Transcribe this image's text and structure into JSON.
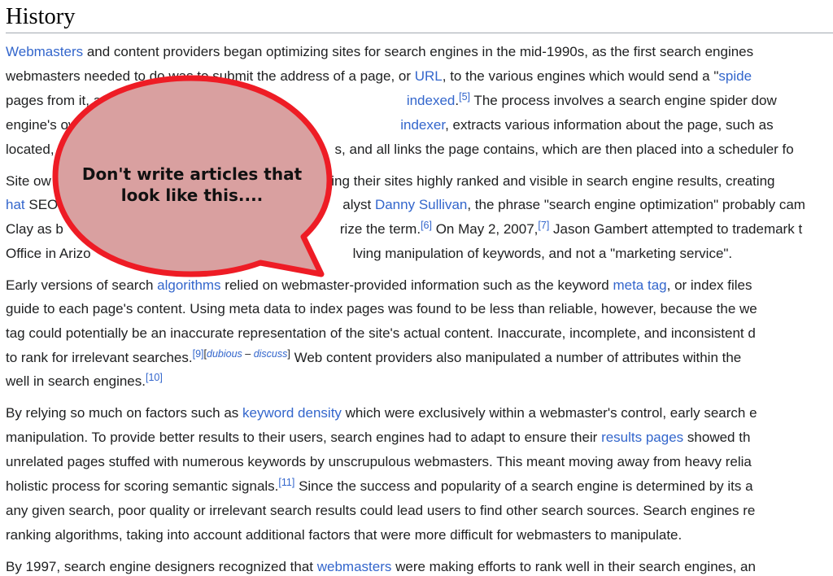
{
  "heading": "History",
  "callout": {
    "line1": "Don't write articles that",
    "line2": "look like this....",
    "fill": "#d9a0a0",
    "stroke": "#ee1c25"
  },
  "colors": {
    "link": "#3366cc",
    "text": "#202122"
  },
  "p1": {
    "l1": {
      "a": "Webmasters",
      "b": " and content providers began optimizing sites for search engines in the mid-1990s, as the first search engines"
    },
    "l2": {
      "a": "webmasters needed to do was to submit the address of a page, or ",
      "b": "URL",
      "c": ", to the various engines which would send a \"",
      "d": "spide"
    },
    "l3": {
      "a": "pages from it, and ",
      "b": "indexed",
      "c": "[5]",
      "d": " The process involves a search engine spider dow"
    },
    "l4": {
      "a": "engine's ow",
      "b": "indexer",
      "c": ", extracts various information about the page, such as"
    },
    "l5": {
      "a": "located,",
      "b": "s, and all links the page contains, which are then placed into a scheduler fo"
    }
  },
  "p2": {
    "l1": {
      "a": "Site ow",
      "b": "ying their sites highly ranked and visible in search engine results, creating"
    },
    "l2": {
      "a": "hat",
      "b": " SEO",
      "c": "alyst ",
      "d": "Danny Sullivan",
      "e": ", the phrase \"search engine optimization\" probably cam"
    },
    "l3": {
      "a": "Clay as b",
      "b": "rize the term.",
      "c": "[6]",
      "d": " On May 2, 2007,",
      "e": "[7]",
      "f": " Jason Gambert attempted to trademark t"
    },
    "l4": {
      "a": "Office in Arizo",
      "b": "lving manipulation of keywords, and not a \"marketing service\"."
    }
  },
  "p3": {
    "l1": {
      "a": "Early versions of search ",
      "b": "algorithms",
      "c": " relied on webmaster-provided information such as the keyword ",
      "d": "meta tag",
      "e": ", or index files"
    },
    "l2": {
      "a": "guide to each page's content. Using meta data to index pages was found to be less than reliable, however, because the we"
    },
    "l3": {
      "a": "tag could potentially be an inaccurate representation of the site's actual content. Inaccurate, incomplete, and inconsistent d"
    },
    "l4": {
      "a": "to rank for irrelevant searches.",
      "b": "[9]",
      "c": "[",
      "d": "dubious",
      "e": " – ",
      "f": "discuss",
      "g": "]",
      "h": " Web content providers also manipulated a number of attributes within the"
    },
    "l5": {
      "a": "well in search engines.",
      "b": "[10]"
    }
  },
  "p4": {
    "l1": {
      "a": "By relying so much on factors such as ",
      "b": "keyword density",
      "c": " which were exclusively within a webmaster's control, early search e"
    },
    "l2": {
      "a": "manipulation. To provide better results to their users, search engines had to adapt to ensure their ",
      "b": "results pages",
      "c": " showed th"
    },
    "l3": {
      "a": "unrelated pages stuffed with numerous keywords by unscrupulous webmasters. This meant moving away from heavy relia"
    },
    "l4": {
      "a": "holistic process for scoring semantic signals.",
      "b": "[11]",
      "c": " Since the success and popularity of a search engine is determined by its a"
    },
    "l5": {
      "a": "any given search, poor quality or irrelevant search results could lead users to find other search sources. Search engines re"
    },
    "l6": {
      "a": "ranking algorithms, taking into account additional factors that were more difficult for webmasters to manipulate."
    }
  },
  "p5": {
    "l1": {
      "a": "By 1997, search engine designers recognized that ",
      "b": "webmasters",
      "c": " were making efforts to rank well in their search engines, an"
    }
  }
}
